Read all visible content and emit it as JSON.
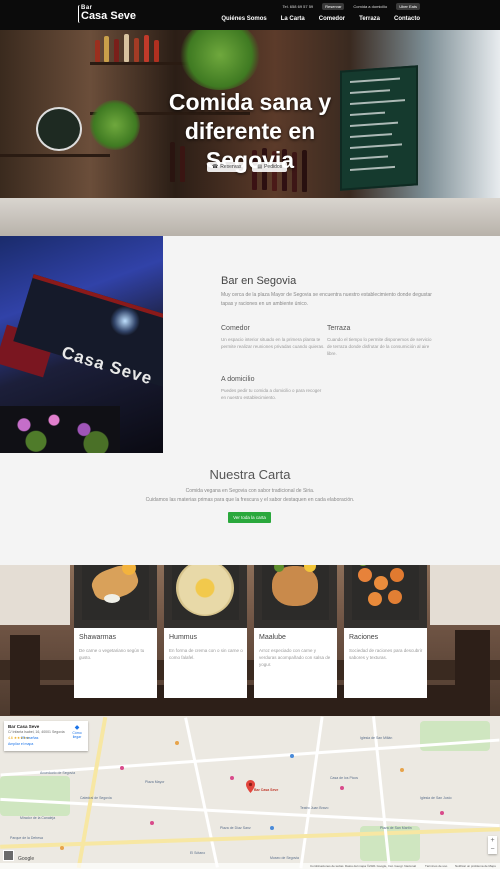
{
  "header": {
    "logo_small": "Bar",
    "logo_name": "Casa Seve",
    "topbar": {
      "phone": "Tel. 658 69 57 59",
      "reservas": "Reservar",
      "comida": "Comida a domicilio",
      "uber": "Uber Eats"
    },
    "nav": [
      "Quiénes Somos",
      "La Carta",
      "Comedor",
      "Terraza",
      "Contacto"
    ]
  },
  "hero": {
    "title": "Comida sana y diferente en Segovia",
    "btn_reservas": "Reservas",
    "btn_pedidos": "Pedidos"
  },
  "about": {
    "facade_sign": "Casa Seve",
    "title": "Bar en Segovia",
    "intro": "Muy cerca de la plaza Mayor de Segovia se encuentra nuestro establecimiento donde degustar tapas y raciones en un ambiente único.",
    "comedor_title": "Comedor",
    "comedor_text": "Un espacio interior situado en la primera planta te permite realizar reuniones privadas cuando quieras.",
    "terraza_title": "Terraza",
    "terraza_text": "Cuando el tiempo lo permite disponemos de servicio de terraza donde disfrutar de la consumición al aire libre.",
    "domicilio_title": "A domicilio",
    "domicilio_text": "Puedes pedir tu comida a domicilio o para recoger en nuestro establecimiento."
  },
  "carta": {
    "title": "Nuestra Carta",
    "subtitle_1": "Comida vegana en Segovia con sabor tradicional de Siria.",
    "subtitle_2": "Cuidamos las materias primas para que la frescura y el sabor destaquen en cada elaboración.",
    "cta": "Ver toda la carta"
  },
  "dishes": [
    {
      "title": "Shawarmas",
      "desc": "De carne o vegetariano según tu gusto."
    },
    {
      "title": "Hummus",
      "desc": "En forma de crema con o sin carne o como falafel."
    },
    {
      "title": "Maalube",
      "desc": "Arroz especiado con carne y verduras acompañado con salsa de yogur."
    },
    {
      "title": "Raciones",
      "desc": "Sociedad de raciones para descubrir sabores y texturas."
    }
  ],
  "map": {
    "card_title": "Bar Casa Seve",
    "card_address": "C/ Infanta Isabel, 16, 40001 Segovia",
    "card_rating": "4.6 ★★★★★",
    "card_reviews": "25 reseñas",
    "card_larger": "Ampliar el mapa",
    "card_directions": "Cómo llegar",
    "google": "Google",
    "footer_shortcuts": "Combinaciones de teclas",
    "footer_data": "Datos del mapa ©2021 Google, Inst. Geogr. Nacional",
    "footer_terms": "Términos de uso",
    "footer_report": "Notificar un problema de Maps",
    "labels": [
      "Acueducto de Segovia",
      "Plaza Mayor",
      "Catedral de Segovia",
      "Mirador de la Canaleja",
      "Parque de la Dehesa",
      "Iglesia de San Millán",
      "Bar Casa Seve",
      "Teatro Juan Bravo",
      "Plaza de Díaz Sanz",
      "Museo de Segovia",
      "Plaza de San Martín",
      "El Sótano",
      "Casa de los Picos",
      "Iglesia de San Justo"
    ]
  },
  "colors": {
    "header_bg": "#0b0b0b",
    "cta_green": "#2aa83c",
    "section_bg": "#f4f4f4"
  }
}
